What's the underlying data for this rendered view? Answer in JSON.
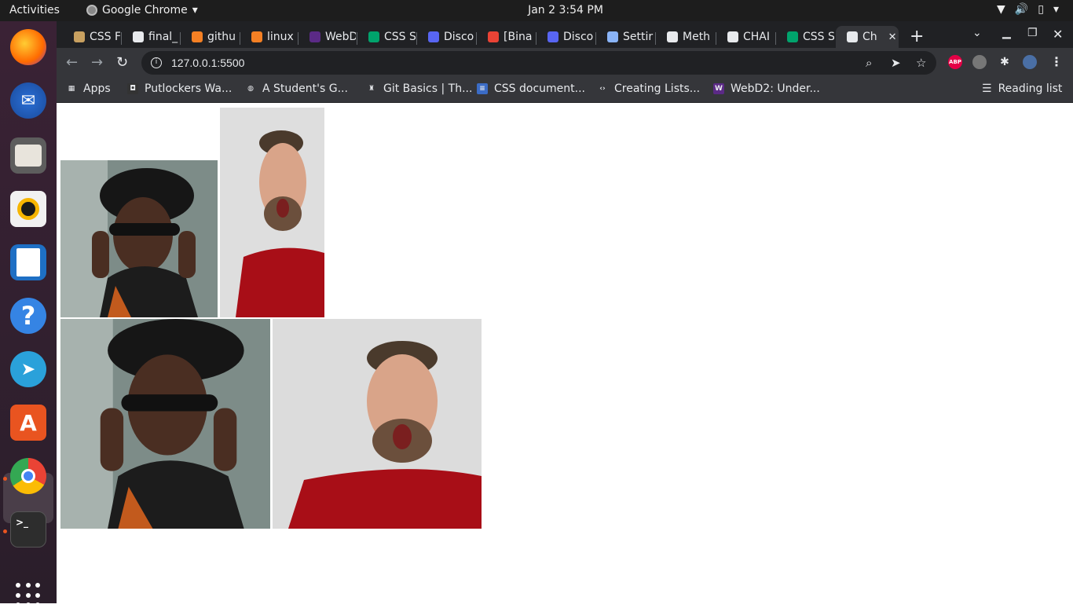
{
  "system": {
    "activities": "Activities",
    "app_name": "Google Chrome",
    "clock": "Jan 2   3:54 PM"
  },
  "tabs": [
    {
      "label": "CSS F",
      "icon": "figure-icon",
      "color": "#c8a060"
    },
    {
      "label": "final_",
      "icon": "github-icon",
      "color": "#e8eaed"
    },
    {
      "label": "githu",
      "icon": "stackoverflow-icon",
      "color": "#f48024"
    },
    {
      "label": "linux",
      "icon": "stackoverflow-icon",
      "color": "#f48024"
    },
    {
      "label": "WebD",
      "icon": "w-icon",
      "color": "#5b2a86"
    },
    {
      "label": "CSS S",
      "icon": "w-green-icon",
      "color": "#00a36c"
    },
    {
      "label": "Disco",
      "icon": "discord-icon",
      "color": "#5865f2"
    },
    {
      "label": "[Bina",
      "icon": "gmail-icon",
      "color": "#ea4335"
    },
    {
      "label": "Disco",
      "icon": "discord-icon",
      "color": "#5865f2"
    },
    {
      "label": "Settir",
      "icon": "gear-icon",
      "color": "#8ab4f8"
    },
    {
      "label": "Meth",
      "icon": "globe-icon",
      "color": "#e8eaed"
    },
    {
      "label": "CHAI",
      "icon": "globe-icon",
      "color": "#e8eaed"
    },
    {
      "label": "CSS S",
      "icon": "w-green-icon",
      "color": "#00a36c"
    },
    {
      "label": "Ch",
      "icon": "globe-icon",
      "color": "#e8eaed",
      "active": true
    }
  ],
  "address": {
    "url": "127.0.0.1:5500"
  },
  "bookmarks": [
    {
      "label": "Apps",
      "icon": "apps-grid-icon"
    },
    {
      "label": "Putlockers Wa...",
      "icon": "putlockers-icon"
    },
    {
      "label": "A Student's G...",
      "icon": "globe-icon"
    },
    {
      "label": "Git Basics | Th...",
      "icon": "figure-icon"
    },
    {
      "label": "CSS document...",
      "icon": "docs-icon"
    },
    {
      "label": "Creating Lists...",
      "icon": "code-icon"
    },
    {
      "label": "WebD2: Under...",
      "icon": "w-icon"
    }
  ],
  "reading_list": "Reading list",
  "extensions": {
    "abp": "ABP"
  },
  "colors": {
    "chrome_dark": "#202124",
    "chrome_toolbar": "#35363a",
    "dock_bg": "#2b1f2b",
    "accent_orange": "#e95420"
  }
}
